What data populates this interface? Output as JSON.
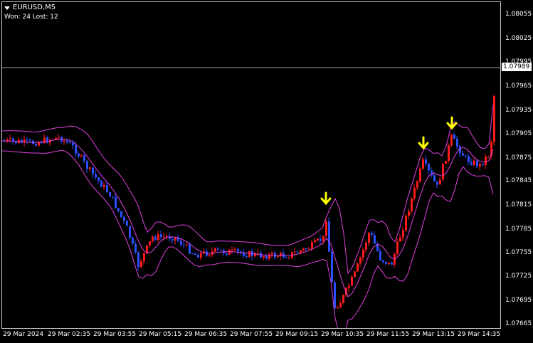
{
  "header": {
    "symbol": "EURUSD,M5",
    "stats": "Won: 24  Lost: 12",
    "dropdown_icon": "triangle-down-icon"
  },
  "price_scale": {
    "labels": [
      "1.08055",
      "1.08025",
      "1.07995",
      "1.07965",
      "1.07935",
      "1.07905",
      "1.07875",
      "1.07845",
      "1.07815",
      "1.07785",
      "1.07755",
      "1.07725",
      "1.07695",
      "1.07665"
    ],
    "current_price": "1.07989"
  },
  "time_scale": {
    "labels": [
      "29 Mar 2024",
      "29 Mar 02:35",
      "29 Mar 03:55",
      "29 Mar 05:15",
      "29 Mar 06:35",
      "29 Mar 07:55",
      "29 Mar 09:15",
      "29 Mar 10:35",
      "29 Mar 11:55",
      "29 Mar 13:15",
      "29 Mar 14:35"
    ]
  },
  "chart": {
    "bull_color": "#ff1a1a",
    "bear_color": "#2a50ff",
    "band_color": "#e040e0",
    "arrow_color": "#ffff00",
    "grid": false,
    "signals": [
      {
        "type": "down-arrow",
        "time_index": 0
      },
      {
        "type": "down-arrow",
        "time_index": 1
      },
      {
        "type": "down-arrow",
        "time_index": 2
      }
    ]
  }
}
